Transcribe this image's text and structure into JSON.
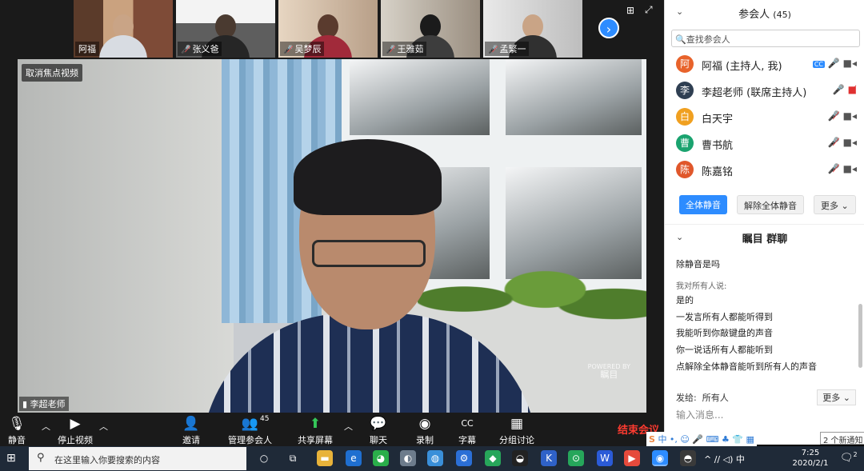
{
  "meeting": {
    "thumbnails": [
      {
        "name": "阿福",
        "muted": false
      },
      {
        "name": "张义爸",
        "muted": true
      },
      {
        "name": "吴梦辰",
        "muted": true
      },
      {
        "name": "王雅茹",
        "muted": true
      },
      {
        "name": "孟繁一",
        "muted": true
      }
    ],
    "next_page_icon": "chevron-right-icon",
    "unfocus_label": "取消焦点视频",
    "speaker_label": "李超老师",
    "powered_by": "POWERED BY",
    "powered_logo": "瞩目"
  },
  "toolbar": {
    "mute": "静音",
    "stop_video": "停止视频",
    "invite": "邀请",
    "manage_participants": "管理参会人",
    "participant_count": "45",
    "share_screen": "共享屏幕",
    "chat": "聊天",
    "record": "录制",
    "captions": "字幕",
    "breakout": "分组讨论",
    "end_meeting": "结束会议"
  },
  "participants_panel": {
    "title": "参会人",
    "count": "(45)",
    "search_placeholder": "查找参会人",
    "participants": [
      {
        "avatar": "阿",
        "name": "阿福 (主持人, 我)",
        "color": "#e8632b",
        "cc": true,
        "audio_muted": false,
        "video_on": true
      },
      {
        "avatar": "李",
        "name": "李超老师 (联席主持人)",
        "color": "#2f3f52",
        "cc": false,
        "audio_muted": false,
        "video_on": false
      },
      {
        "avatar": "白",
        "name": "白天宇",
        "color": "#f0a020",
        "cc": false,
        "audio_muted": true,
        "video_on": true
      },
      {
        "avatar": "曹",
        "name": "曹书航",
        "color": "#1aa36f",
        "cc": false,
        "audio_muted": true,
        "video_on": true
      },
      {
        "avatar": "陈",
        "name": "陈嘉铭",
        "color": "#e0572b",
        "cc": false,
        "audio_muted": true,
        "video_on": true
      }
    ],
    "mute_all": "全体静音",
    "unmute_all": "解除全体静音",
    "more": "更多 ⌄"
  },
  "chat_panel": {
    "title": "瞩目 群聊",
    "messages": [
      {
        "text": "除静音是吗",
        "meta": false
      },
      {
        "text": "我对所有人说:",
        "meta": true
      },
      {
        "text": "是的",
        "meta": false
      },
      {
        "text": "一发言所有人都能听得到",
        "meta": false
      },
      {
        "text": "我能听到你敲键盘的声音",
        "meta": false
      },
      {
        "text": "你一说话所有人都能听到",
        "meta": false
      },
      {
        "text": "点解除全体静音能听到所有人的声音",
        "meta": false
      }
    ],
    "send_to_label": "发给:",
    "send_to_value": "所有人",
    "send_to_more": "更多 ⌄",
    "input_placeholder": "输入消息..."
  },
  "ime": {
    "label": "中 •, ☺ 🎤 ⌨ ♣ 👕 ▦",
    "notification": "2 个新通知"
  },
  "taskbar": {
    "search_placeholder": "在这里输入你要搜索的内容",
    "tray": "^ ∕∕ ◁) 中",
    "time": "7:25",
    "date": "2020/2/1",
    "notification_count": "2"
  },
  "colors": {
    "accent": "#2d8cff",
    "danger": "#ff3b30",
    "share_green": "#35c759"
  }
}
